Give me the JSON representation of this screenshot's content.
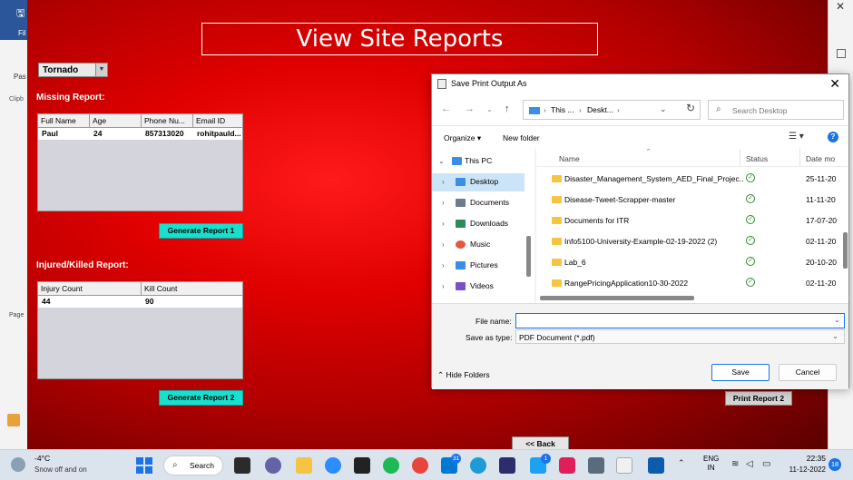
{
  "background_app": {
    "file_label": "Fil",
    "paste_label": "Pas",
    "clipboard_label": "Clipb",
    "page_label": "Page"
  },
  "app": {
    "title": "View Site Reports",
    "disaster_select": {
      "value": "Tornado"
    },
    "missing_report": {
      "label": "Missing Report:",
      "columns": [
        "Full Name",
        "Age",
        "Phone Nu...",
        "Email ID"
      ],
      "rows": [
        [
          "Paul",
          "24",
          "857313020",
          "rohitpauld..."
        ]
      ],
      "button": "Generate Report 1"
    },
    "injured_report": {
      "label": "Injured/Killed Report:",
      "columns": [
        "Injury Count",
        "Kill Count"
      ],
      "rows": [
        [
          "44",
          "90"
        ]
      ],
      "button": "Generate Report 2"
    },
    "print_report_2": "Print Report 2",
    "back": "<< Back"
  },
  "dialog": {
    "title": "Save Print Output As",
    "address": [
      "This ...",
      "Deskt..."
    ],
    "search_placeholder": "Search Desktop",
    "organize": "Organize",
    "new_folder": "New folder",
    "tree": [
      {
        "label": "This PC",
        "icon": "pc-icon",
        "color": "#3a8ee6"
      },
      {
        "label": "Desktop",
        "icon": "desktop-icon",
        "color": "#3a8ee6",
        "selected": true
      },
      {
        "label": "Documents",
        "icon": "documents-icon",
        "color": "#6b7b8c"
      },
      {
        "label": "Downloads",
        "icon": "downloads-icon",
        "color": "#2e8b57"
      },
      {
        "label": "Music",
        "icon": "music-icon",
        "color": "#e05a3a"
      },
      {
        "label": "Pictures",
        "icon": "pictures-icon",
        "color": "#3a8ee6"
      },
      {
        "label": "Videos",
        "icon": "videos-icon",
        "color": "#7b4fc9"
      }
    ],
    "columns": {
      "name": "Name",
      "status": "Status",
      "date": "Date mo"
    },
    "files": [
      {
        "name": "Disaster_Management_System_AED_Final_Projec...",
        "date": "25-11-20"
      },
      {
        "name": "Disease-Tweet-Scrapper-master",
        "date": "11-11-20"
      },
      {
        "name": "Documents for ITR",
        "date": "17-07-20"
      },
      {
        "name": "Info5100-University-Example-02-19-2022 (2)",
        "date": "02-11-20"
      },
      {
        "name": "Lab_6",
        "date": "20-10-20"
      },
      {
        "name": "RangePricingApplication10-30-2022",
        "date": "02-11-20"
      }
    ],
    "file_name_label": "File name:",
    "file_name_value": "",
    "save_type_label": "Save as type:",
    "save_type_value": "PDF Document (*.pdf)",
    "hide_folders": "Hide Folders",
    "save": "Save",
    "cancel": "Cancel"
  },
  "taskbar": {
    "temperature": "-4°C",
    "condition": "Snow off and on",
    "search": "Search",
    "badges": {
      "mail": "31",
      "twitter": "1"
    },
    "language": [
      "ENG",
      "IN"
    ],
    "time": "22:35",
    "date": "11-12-2022",
    "notifications": "18"
  }
}
